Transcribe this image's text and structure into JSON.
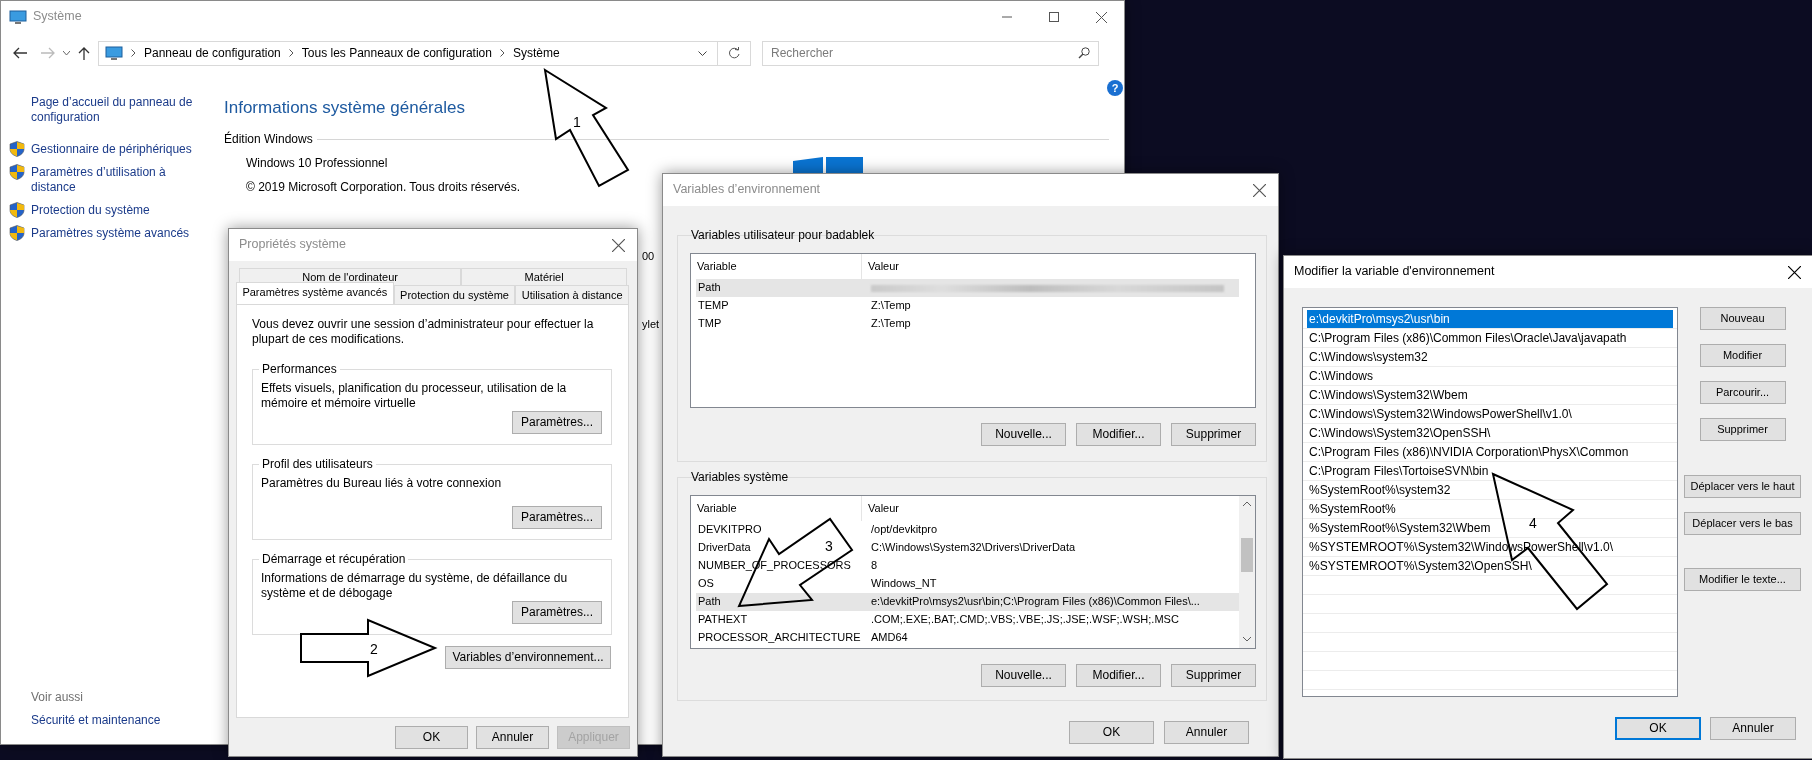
{
  "system_window": {
    "title": "Système",
    "active": false,
    "address_bar": {
      "breadcrumb": [
        "Panneau de configuration",
        "Tous les Panneaux de configuration",
        "Système"
      ],
      "search": {
        "placeholder": "Rechercher"
      }
    },
    "help_button": "?",
    "sidebar": {
      "items": [
        {
          "label": "Page d’accueil du panneau de configuration",
          "kind": "link"
        },
        {
          "label": "Gestionnaire de périphériques",
          "kind": "shield-link"
        },
        {
          "label": "Paramètres d’utilisation à distance",
          "kind": "shield-link"
        },
        {
          "label": "Protection du système",
          "kind": "shield-link"
        },
        {
          "label": "Paramètres système avancés",
          "kind": "shield-link"
        }
      ],
      "see_also": {
        "heading": "Voir aussi",
        "links": [
          "Sécurité et maintenance"
        ]
      }
    },
    "main": {
      "heading": "Informations système générales",
      "section": "Édition Windows",
      "lines": [
        "Windows 10 Professionnel",
        "© 2019 Microsoft Corporation. Tous droits réservés."
      ],
      "fragments": [
        "00",
        "ylet"
      ]
    }
  },
  "system_properties": {
    "title": "Propriétés système",
    "active": false,
    "tab_rows": [
      [
        {
          "label": "Nom de l'ordinateur",
          "selected": false
        },
        {
          "label": "Matériel",
          "selected": false
        }
      ],
      [
        {
          "label": "Paramètres système avancés",
          "selected": true
        },
        {
          "label": "Protection du système",
          "selected": false
        },
        {
          "label": "Utilisation à distance",
          "selected": false
        }
      ]
    ],
    "notice": "Vous devez ouvrir une session d’administrateur pour effectuer la plupart de ces modifications.",
    "groups": [
      {
        "title": "Performances",
        "text": "Effets visuels, planification du processeur, utilisation de la mémoire et mémoire virtuelle",
        "button": "Paramètres..."
      },
      {
        "title": "Profil des utilisateurs",
        "text": "Paramètres du Bureau liés à votre connexion",
        "button": "Paramètres..."
      },
      {
        "title": "Démarrage et récupération",
        "text": "Informations de démarrage du système, de défaillance du système et de débogage",
        "button": "Paramètres..."
      }
    ],
    "env_button": "Variables d’environnement...",
    "buttons": [
      {
        "label": "OK",
        "disabled": false
      },
      {
        "label": "Annuler",
        "disabled": false
      },
      {
        "label": "Appliquer",
        "disabled": true
      }
    ]
  },
  "environment_variables": {
    "title": "Variables d’environnement",
    "active": false,
    "user_variables": {
      "title": "Variables utilisateur pour badablek",
      "columns": [
        "Variable",
        "Valeur"
      ],
      "rows": [
        {
          "variable": "Path",
          "blurred": true,
          "selected": true
        },
        {
          "variable": "TEMP",
          "value": "Z:\\Temp",
          "blurred": false,
          "selected": false
        },
        {
          "variable": "TMP",
          "value": "Z:\\Temp",
          "blurred": false,
          "selected": false
        }
      ],
      "buttons": [
        "Nouvelle...",
        "Modifier...",
        "Supprimer"
      ]
    },
    "system_variables": {
      "title": "Variables système",
      "columns": [
        "Variable",
        "Valeur"
      ],
      "rows": [
        {
          "variable": "DEVKITPRO",
          "value": "/opt/devkitpro",
          "blurred": false,
          "selected": false
        },
        {
          "variable": "DriverData",
          "value": "C:\\Windows\\System32\\Drivers\\DriverData",
          "blurred": false,
          "selected": false
        },
        {
          "variable": "NUMBER_OF_PROCESSORS",
          "value": "8",
          "blurred": false,
          "selected": false
        },
        {
          "variable": "OS",
          "value": "Windows_NT",
          "blurred": false,
          "selected": false
        },
        {
          "variable": "Path",
          "value": "e:\\devkitPro\\msys2\\usr\\bin;C:\\Program Files (x86)\\Common Files\\...",
          "blurred": false,
          "selected": true
        },
        {
          "variable": "PATHEXT",
          "value": ".COM;.EXE;.BAT;.CMD;.VBS;.VBE;.JS;.JSE;.WSF;.WSH;.MSC",
          "blurred": false,
          "selected": false
        },
        {
          "variable": "PROCESSOR_ARCHITECTURE",
          "value": "AMD64",
          "blurred": false,
          "selected": false
        }
      ],
      "buttons": [
        "Nouvelle...",
        "Modifier...",
        "Supprimer"
      ]
    },
    "buttons": [
      "OK",
      "Annuler"
    ]
  },
  "edit_variable": {
    "title": "Modifier la variable d'environnement",
    "active": true,
    "entries": [
      {
        "text": "e:\\devkitPro\\msys2\\usr\\bin",
        "selected": true
      },
      {
        "text": "C:\\Program Files (x86)\\Common Files\\Oracle\\Java\\javapath",
        "selected": false
      },
      {
        "text": "C:\\Windows\\system32",
        "selected": false
      },
      {
        "text": "C:\\Windows",
        "selected": false
      },
      {
        "text": "C:\\Windows\\System32\\Wbem",
        "selected": false
      },
      {
        "text": "C:\\Windows\\System32\\WindowsPowerShell\\v1.0\\",
        "selected": false
      },
      {
        "text": "C:\\Windows\\System32\\OpenSSH\\",
        "selected": false
      },
      {
        "text": "C:\\Program Files (x86)\\NVIDIA Corporation\\PhysX\\Common",
        "selected": false
      },
      {
        "text": "C:\\Program Files\\TortoiseSVN\\bin",
        "selected": false
      },
      {
        "text": "%SystemRoot%\\system32",
        "selected": false
      },
      {
        "text": "%SystemRoot%",
        "selected": false
      },
      {
        "text": "%SystemRoot%\\System32\\Wbem",
        "selected": false
      },
      {
        "text": "%SYSTEMROOT%\\System32\\WindowsPowerShell\\v1.0\\",
        "selected": false
      },
      {
        "text": "%SYSTEMROOT%\\System32\\OpenSSH\\",
        "selected": false
      }
    ],
    "buttons": [
      "Nouveau",
      "Modifier",
      "Parcourir...",
      "Supprimer",
      "Déplacer vers le haut",
      "Déplacer vers le bas",
      "Modifier le texte..."
    ],
    "footer_buttons": [
      {
        "label": "OK",
        "default": true
      },
      {
        "label": "Annuler",
        "default": false
      }
    ]
  },
  "callouts": [
    {
      "label": "1"
    },
    {
      "label": "2"
    },
    {
      "label": "3"
    },
    {
      "label": "4"
    }
  ]
}
